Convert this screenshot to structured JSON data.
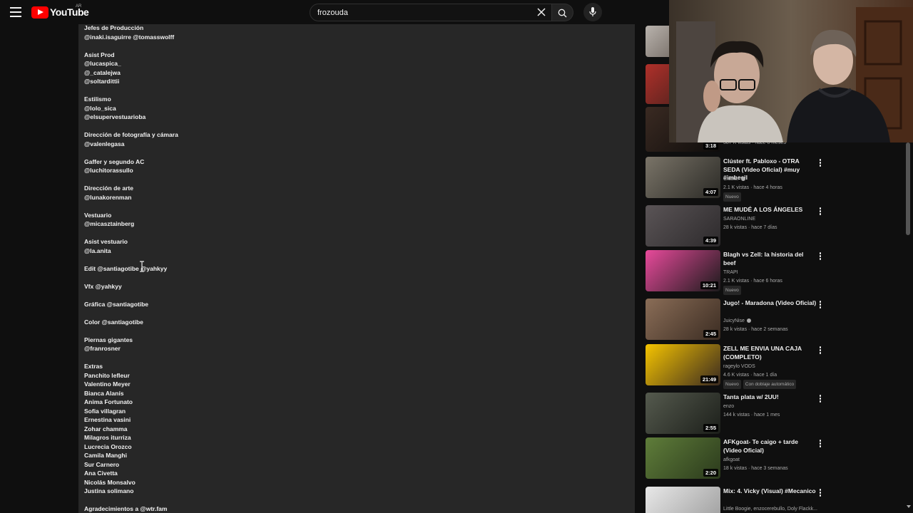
{
  "header": {
    "logo_text": "YouTube",
    "region": "AR",
    "search_value": "frozouda"
  },
  "description_lines": [
    "Jefes de Producción",
    "@inaki.isaguirre @tomasswolff",
    "",
    "Asist Prod",
    "@lucaspica_",
    "@_catalejwa",
    "@soltardittii",
    "",
    "Estilismo",
    "@lolo_sica",
    "@elsupervestuarioba",
    "",
    "Dirección de fotografía y cámara",
    "@valenlegasa",
    "",
    "Gaffer y segundo AC",
    "@luchitorassullo",
    "",
    "Dirección de arte",
    "@lunakorenman",
    "",
    "Vestuario",
    "@micasztainberg",
    "",
    "Asist vestuario",
    "@la.anita",
    "",
    "Edit @santiagotibe @yahkyy",
    "",
    "Vfx @yahkyy",
    "",
    "Gráfica @santiagotibe",
    "",
    "Color @santiagotibe",
    "",
    "Piernas gigantes",
    "@franrosner",
    "",
    "Extras",
    "Panchito lefleur",
    "Valentino Meyer",
    "Bianca Alanís",
    "Anima Fortunato",
    "Sofia villagran",
    "Ernestina vasini",
    "Zohar chamma",
    "Milagros iturriza",
    "Lucrecia Orozco",
    "Camila Manghi",
    "Sur Carnero",
    "Ana Civetta",
    "Nicolás Monsalvo",
    "Justina solimano",
    "",
    "Agradecimientos a @wtr.fam"
  ],
  "partial_item": {
    "duration": "3:18",
    "meta": "387 K vistas · hace 8 meses"
  },
  "videos": [
    {
      "title": "Clúster ft. Pabloxo - OTRA SEDA (Video Oficial) #muy #imbecil",
      "channel": "Clúster",
      "verified": true,
      "stats": "2.1 K vistas · hace 4 horas",
      "badges": [
        "Nuevo"
      ],
      "duration": "4:07",
      "thumb_colors": [
        "#7a7468",
        "#2b2a26"
      ]
    },
    {
      "title": "ME MUDÉ A LOS ÁNGELES",
      "channel": "SARAONLINE",
      "verified": false,
      "stats": "28 k vistas · hace 7 días",
      "badges": [],
      "duration": "4:39",
      "thumb_colors": [
        "#5a5456",
        "#2d2a2c"
      ]
    },
    {
      "title": "Blagh vs Zell: la historia del beef",
      "channel": "TRAPI",
      "verified": false,
      "stats": "2.1 K vistas · hace 6 horas",
      "badges": [
        "Nuevo"
      ],
      "duration": "10:21",
      "thumb_colors": [
        "#e84a9b",
        "#1b1b1b"
      ]
    },
    {
      "title": "Jugo! - Maradona (Video Oficial)",
      "channel": "JuicyNise",
      "verified": true,
      "stats": "28 k vistas · hace 2 semanas",
      "badges": [],
      "duration": "2:45",
      "thumb_colors": [
        "#8a6d57",
        "#3b2c22"
      ]
    },
    {
      "title": "ZELL ME ENVIA UNA CAJA (COMPLETO)",
      "channel": "rageylo VODS",
      "verified": false,
      "stats": "4.6 K vistas · hace 1 día",
      "badges": [
        "Nuevo",
        "Con doblaje automático"
      ],
      "duration": "21:49",
      "thumb_colors": [
        "#f5c400",
        "#3a2a20"
      ]
    },
    {
      "title": "Tanta plata w/ 2UU!",
      "channel": "enzo",
      "verified": false,
      "stats": "144 k vistas · hace 1 mes",
      "badges": [],
      "duration": "2:55",
      "thumb_colors": [
        "#555a4e",
        "#1c1f1a"
      ]
    },
    {
      "title": "AFKgoat- Te caigo + tarde (Video Oficial)",
      "channel": "afkgoat",
      "verified": false,
      "stats": "18 k vistas · hace 3 semanas",
      "badges": [],
      "duration": "2:20",
      "thumb_colors": [
        "#5f7d3a",
        "#2b3a1c"
      ]
    },
    {
      "title": "Mix: 4. Vicky (Visual) #Mecanico",
      "channel": "Little Boogie, enzocerebullo, Doly Flackk...",
      "verified": false,
      "stats": "",
      "badges": [],
      "duration": "",
      "thumb_colors": [
        "#e8e8e8",
        "#9a9a9a"
      ]
    }
  ],
  "colors": {
    "background": "#0f0f0f",
    "description_bg": "#272727",
    "brand_red": "#ff0000",
    "meta_text": "#aaaaaa"
  }
}
